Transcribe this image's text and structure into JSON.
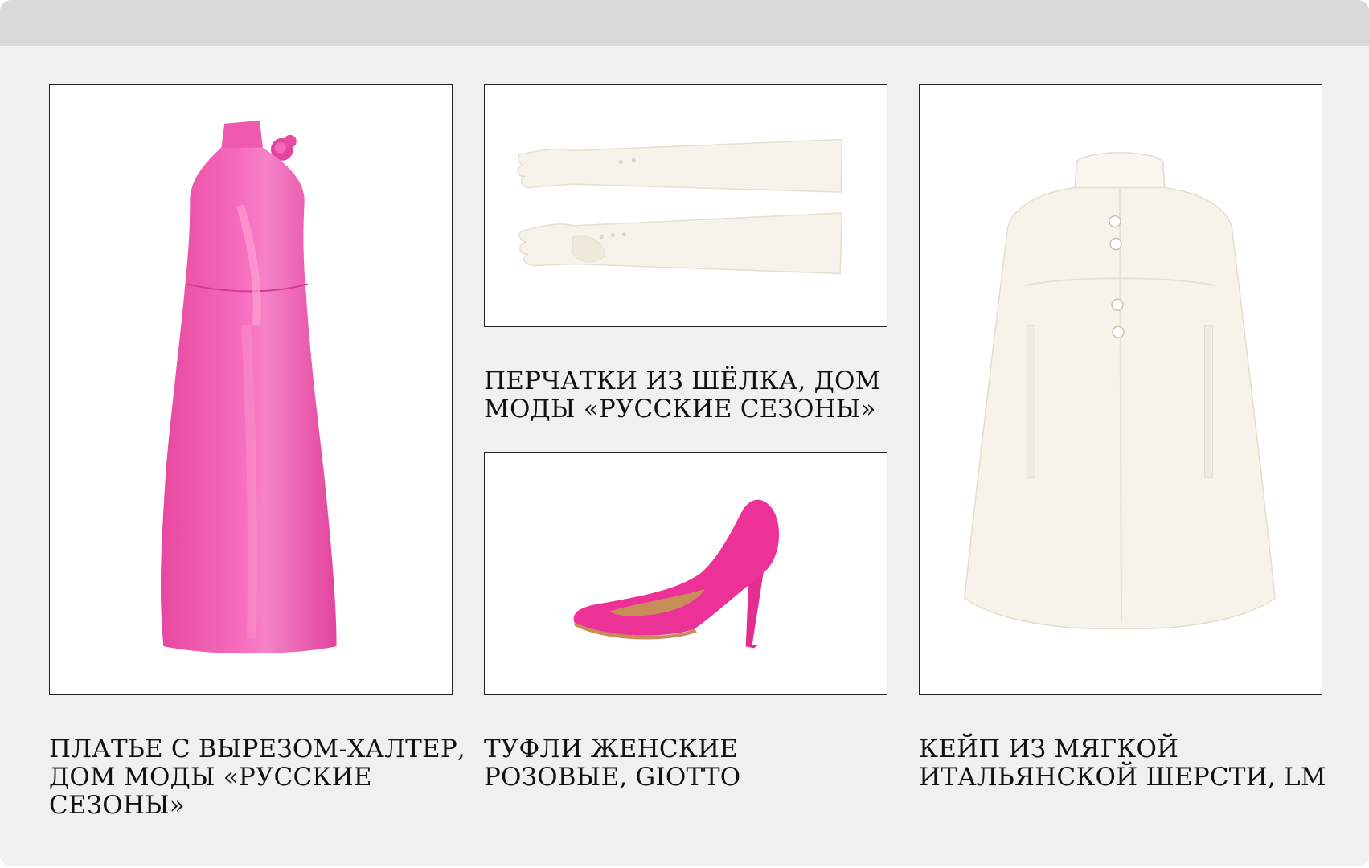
{
  "colors": {
    "background": "#f0f0f0",
    "top_bar": "#d9d9d9",
    "card": "#ffffff",
    "dress_pink": "#f05bb0",
    "shoe_pink": "#ec2f97",
    "ivory": "#f6f3ea"
  },
  "products": {
    "dress": {
      "image_icon": "pink-halter-dress-image",
      "caption": "ПЛАТЬЕ С ВЫРЕЗОМ-ХАЛТЕР, ДОМ МОДЫ «РУССКИЕ СЕЗОНЫ»"
    },
    "gloves": {
      "image_icon": "ivory-silk-gloves-image",
      "caption": "ПЕРЧАТКИ ИЗ ШЁЛКА, ДОМ МОДЫ «РУССКИЕ СЕЗОНЫ»"
    },
    "shoes": {
      "image_icon": "pink-suede-pump-image",
      "caption": "ТУФЛИ ЖЕНСКИЕ РОЗОВЫЕ, GIOTTO"
    },
    "cape": {
      "image_icon": "ivory-wool-cape-image",
      "caption": "КЕЙП ИЗ МЯГКОЙ ИТАЛЬЯНСКОЙ ШЕРСТИ, LM"
    }
  }
}
